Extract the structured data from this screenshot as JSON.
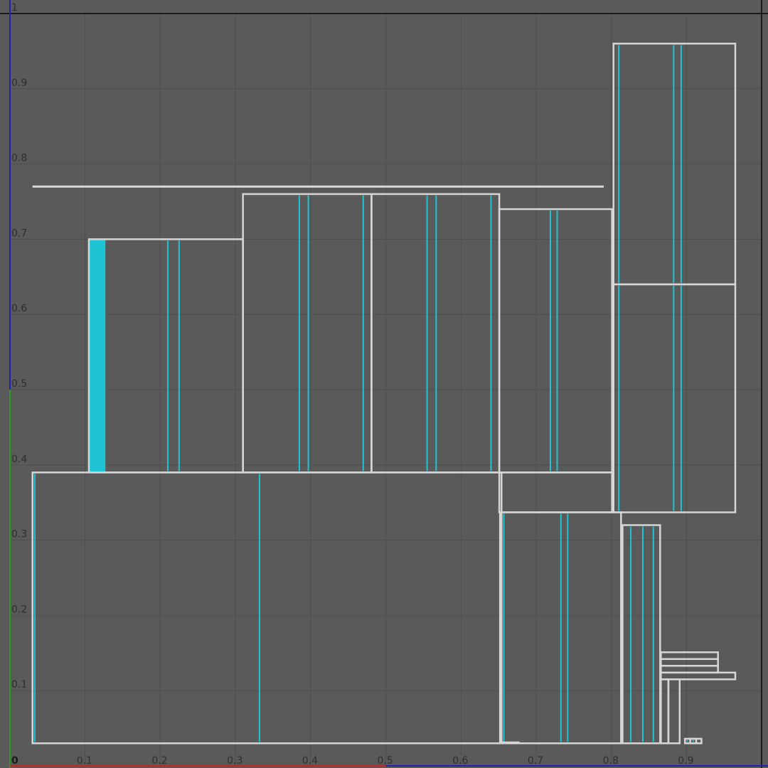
{
  "viewport": {
    "name": "uv-editor-viewport",
    "u_range": [
      0,
      1
    ],
    "v_range": [
      0,
      1
    ],
    "grid_step": 0.1,
    "colors": {
      "background": "#5a5a5a",
      "grid": "#4e4e4e",
      "island_outline": "#d6d6d6",
      "seam": "#1ec3d4",
      "border": "#1c1c1c",
      "u_axis": "#b03030",
      "v_axis_upper": "#2222aa",
      "v_axis_lower": "#2e9a2e"
    }
  },
  "axes": {
    "origin_label": "0",
    "u_ticks": [
      "0.1",
      "0.2",
      "0.3",
      "0.4",
      "0.5",
      "0.6",
      "0.7",
      "0.8",
      "0.9"
    ],
    "v_ticks": [
      "0.1",
      "0.2",
      "0.3",
      "0.4",
      "0.5",
      "0.6",
      "0.7",
      "0.8",
      "0.9",
      "1"
    ]
  },
  "islands": [
    {
      "name": "uv-island-large-bottom",
      "u0": 0.03,
      "v0": 0.03,
      "u1": 0.654,
      "v1": 0.39,
      "seams": [
        0.033,
        0.332
      ]
    },
    {
      "name": "uv-island-left-tall",
      "u0": 0.105,
      "v0": 0.39,
      "u1": 0.31,
      "v1": 0.7,
      "seams": [
        0.21,
        0.225
      ],
      "seam_fill": [
        0.105,
        0.127
      ]
    },
    {
      "name": "uv-island-center-1",
      "u0": 0.31,
      "v0": 0.39,
      "u1": 0.481,
      "v1": 0.76,
      "seams": [
        0.385,
        0.397,
        0.47
      ]
    },
    {
      "name": "uv-island-center-2",
      "u0": 0.481,
      "v0": 0.39,
      "u1": 0.651,
      "v1": 0.76,
      "seams": [
        0.555,
        0.567,
        0.64
      ]
    },
    {
      "name": "uv-island-right-mid",
      "u0": 0.651,
      "v0": 0.39,
      "u1": 0.801,
      "v1": 0.74,
      "seams": [
        0.719,
        0.728
      ]
    },
    {
      "name": "uv-island-right-narrow-band",
      "u0": 0.651,
      "v0": 0.337,
      "u1": 0.801,
      "v1": 0.39,
      "seams": []
    },
    {
      "name": "uv-island-bottom-right",
      "u0": 0.652,
      "v0": 0.03,
      "u1": 0.813,
      "v1": 0.337,
      "seams": [
        0.657,
        0.733,
        0.742
      ]
    },
    {
      "name": "uv-island-far-right-upper",
      "u0": 0.803,
      "v0": 0.64,
      "u1": 0.965,
      "v1": 0.96,
      "seams": [
        0.81,
        0.883,
        0.893
      ]
    },
    {
      "name": "uv-island-far-right-lower",
      "u0": 0.803,
      "v0": 0.337,
      "u1": 0.965,
      "v1": 0.64,
      "seams": [
        0.81,
        0.883,
        0.893
      ]
    },
    {
      "name": "uv-island-strips",
      "u0": 0.815,
      "v0": 0.03,
      "u1": 0.865,
      "v1": 0.32,
      "seams": [
        0.826,
        0.842,
        0.856
      ]
    },
    {
      "name": "uv-island-small-step-1",
      "u0": 0.866,
      "v0": 0.03,
      "u1": 0.876,
      "v1": 0.115,
      "seams": []
    },
    {
      "name": "uv-island-small-step-2",
      "u0": 0.876,
      "v0": 0.03,
      "u1": 0.891,
      "v1": 0.115,
      "seams": []
    },
    {
      "name": "uv-island-small-shelf-1",
      "u0": 0.866,
      "v0": 0.115,
      "u1": 0.965,
      "v1": 0.124,
      "seams": []
    },
    {
      "name": "uv-island-small-shelf-2",
      "u0": 0.866,
      "v0": 0.124,
      "u1": 0.942,
      "v1": 0.133,
      "seams": []
    },
    {
      "name": "uv-island-small-shelf-3",
      "u0": 0.866,
      "v0": 0.133,
      "u1": 0.942,
      "v1": 0.142,
      "seams": []
    },
    {
      "name": "uv-island-small-shelf-4",
      "u0": 0.866,
      "v0": 0.142,
      "u1": 0.942,
      "v1": 0.151,
      "seams": []
    },
    {
      "name": "uv-island-tiny-tab-1",
      "u0": 0.898,
      "v0": 0.03,
      "u1": 0.92,
      "v1": 0.036,
      "seams": [
        0.901,
        0.905
      ]
    },
    {
      "name": "uv-island-tiny-tab-2",
      "u0": 0.905,
      "v0": 0.03,
      "u1": 0.913,
      "v1": 0.036,
      "seams": [
        0.909
      ]
    }
  ],
  "lines": [
    {
      "name": "uv-thin-strip-top-left",
      "u0": 0.03,
      "u1": 0.79,
      "v": 0.77
    },
    {
      "name": "uv-thin-strip-bottom-mid",
      "u0": 0.654,
      "u1": 0.678,
      "v": 0.031
    }
  ]
}
